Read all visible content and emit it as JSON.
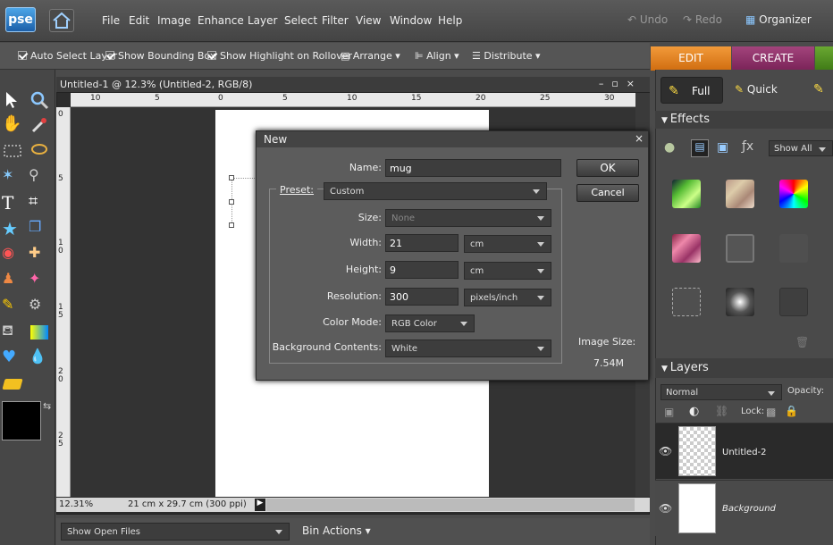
{
  "app": {
    "logo": "pse"
  },
  "menu": [
    "File",
    "Edit",
    "Image",
    "Enhance",
    "Layer",
    "Select",
    "Filter",
    "View",
    "Window",
    "Help"
  ],
  "toolbar": {
    "undo": "Undo",
    "redo": "Redo",
    "organizer": "Organizer"
  },
  "options": {
    "auto_select": "Auto Select Layer",
    "bounding_box": "Show Bounding Box",
    "highlight": "Show Highlight on Rollover",
    "arrange": "Arrange",
    "align": "Align",
    "distribute": "Distribute"
  },
  "mode_tabs": {
    "edit": "EDIT",
    "create": "CREATE"
  },
  "document": {
    "title": "Untitled-1 @ 12.3% (Untitled-2, RGB/8)",
    "zoom": "12.31%",
    "info": "21 cm x 29.7 cm (300 ppi)"
  },
  "ruler": {
    "h_ticks": [
      "10",
      "5",
      "0",
      "5",
      "10",
      "15",
      "20",
      "25",
      "30"
    ],
    "v_ticks": [
      "0",
      "5",
      "1 0",
      "1 5",
      "2 0",
      "2 5"
    ]
  },
  "bin": {
    "show_open": "Show Open Files",
    "bin_actions": "Bin Actions"
  },
  "dialog": {
    "title": "New",
    "name_label": "Name:",
    "name_value": "mug",
    "preset_label": "Preset:",
    "preset_value": "Custom",
    "size_label": "Size:",
    "size_value": "None",
    "width_label": "Width:",
    "width_value": "21",
    "width_unit": "cm",
    "height_label": "Height:",
    "height_value": "9",
    "height_unit": "cm",
    "resolution_label": "Resolution:",
    "resolution_value": "300",
    "resolution_unit": "pixels/inch",
    "color_mode_label": "Color Mode:",
    "color_mode_value": "RGB Color",
    "bg_label": "Background Contents:",
    "bg_value": "White",
    "ok": "OK",
    "cancel": "Cancel",
    "image_size_label": "Image Size:",
    "image_size_value": "7.54M"
  },
  "panels": {
    "full": "Full",
    "quick": "Quick",
    "effects": "Effects",
    "effects_filter": "Show All",
    "layers": "Layers",
    "blend_mode": "Normal",
    "opacity": "Opacity:",
    "lock": "Lock:",
    "layer_items": [
      {
        "name": "Untitled-2"
      },
      {
        "name": "Background"
      }
    ]
  }
}
